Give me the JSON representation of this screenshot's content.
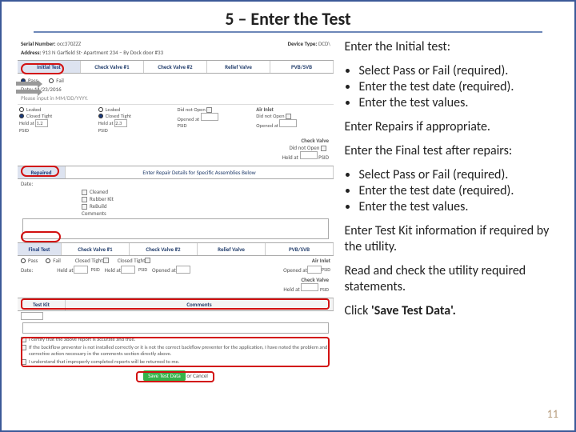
{
  "title": "5 – Enter the Test",
  "page_number": "11",
  "instructions": {
    "initial_heading": "Enter the Initial test:",
    "initial_items": [
      "Select Pass or Fail (required).",
      "Enter the test date (required).",
      "Enter the test values."
    ],
    "repairs": "Enter Repairs if appropriate.",
    "final_heading": "Enter the Final test after repairs:",
    "final_items": [
      "Select Pass or Fail (required).",
      "Enter the test date (required).",
      "Enter the test values."
    ],
    "testkit": "Enter Test Kit information if required by the utility.",
    "read": "Read and check the utility required statements.",
    "click_prefix": "Click ",
    "click_bold": "'Save Test Data'.",
    "click_suffix": ""
  },
  "form": {
    "serial_label": "Serial Number:",
    "serial_value": "occ370ZZZ",
    "device_label": "Device Type:",
    "device_value": "DCD\\",
    "address_label": "Address:",
    "address_value": "913 N Garfield St- Apartment 234 – By Dock door #33",
    "tabs": [
      "Initial Test",
      "Check Valve #1",
      "Check Valve #2",
      "Relief Valve",
      "PVB/SVB"
    ],
    "pass": "Pass",
    "fail": "Fail",
    "date_label": "Date:",
    "date_value": "11/23/2016",
    "date_hint": "Please input in MM/DD/YYYY.",
    "leaked": "Leaked",
    "closed_tight": "Closed Tight",
    "did_not_open": "Did not Open",
    "opened_at": "Opened at",
    "held_at": "Held at",
    "air_inlet": "Air Inlet",
    "check_valve": "Check Valve",
    "psid": "PSID",
    "repaired": "Repaired",
    "repair_details": "Enter Repair Details for Specific Assemblies Below",
    "cleaned": "Cleaned",
    "rubber_kit": "Rubber Kit",
    "rebuild": "ReBuild",
    "comments": "Comments",
    "final_test": "Final Test",
    "test_kit": "Test Kit",
    "disclaimer1": "I certify that the above report is accurate and true.",
    "disclaimer2": "If the backflow preventer is not installed correctly or it is not the correct backflow preventer for the application, I have noted the problem and corrective action necessary in the comments section directly above.",
    "disclaimer3": "I understand that improperly completed reports will be returned to me.",
    "save": "Save Test Data",
    "cancel": "or Cancel",
    "val1": "1.2",
    "val2": "2.3"
  }
}
